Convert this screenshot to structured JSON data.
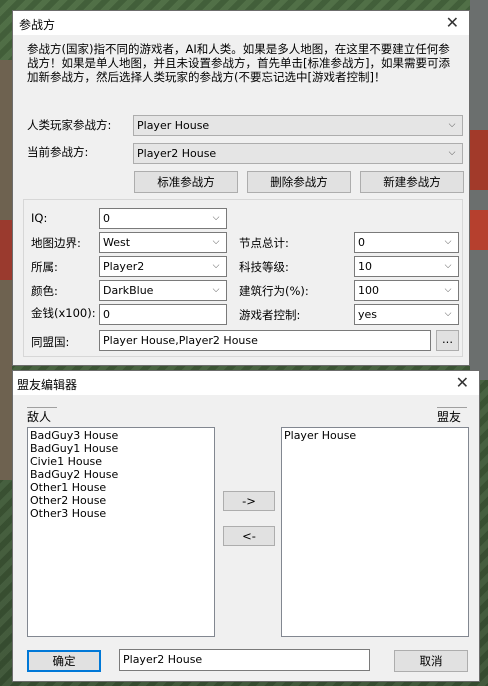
{
  "main_dialog": {
    "title": "参战方",
    "description": "参战方(国家)指不同的游戏者，AI和人类。如果是多人地图，在这里不要建立任何参战方！如果是单人地图，并且未设置参战方，首先单击[标准参战方]，如果需要可添加新参战方，然后选择人类玩家的参战方(不要忘记选中[游戏者控制]！",
    "human_player_label": "人类玩家参战方:",
    "human_player_value": "Player House",
    "current_player_label": "当前参战方:",
    "current_player_value": "Player2 House",
    "buttons": {
      "standard": "标准参战方",
      "delete": "删除参战方",
      "new": "新建参战方"
    },
    "fields": {
      "iq_label": "IQ:",
      "iq_value": "0",
      "edge_label": "地图边界:",
      "edge_value": "West",
      "owner_label": "所属:",
      "owner_value": "Player2",
      "color_label": "颜色:",
      "color_value": "DarkBlue",
      "money_label": "金钱(x100):",
      "money_value": "0",
      "nodes_label": "节点总计:",
      "nodes_value": "0",
      "tech_label": "科技等级:",
      "tech_value": "10",
      "build_label": "建筑行为(%):",
      "build_value": "100",
      "player_control_label": "游戏者控制:",
      "player_control_value": "yes",
      "allies_label": "同盟国:",
      "allies_value": "Player House,Player2 House",
      "browse_label": "..."
    }
  },
  "ally_editor": {
    "title": "盟友编辑器",
    "enemies_label": "敌人",
    "allies_label": "盟友",
    "enemies": [
      "BadGuy3 House",
      "BadGuy1 House",
      "Civie1 House",
      "BadGuy2 House",
      "Other1 House",
      "Other2 House",
      "Other3 House"
    ],
    "allies": [
      "Player House"
    ],
    "move_right_label": "->",
    "move_left_label": "<-",
    "ok_label": "确定",
    "house_value": "Player2 House",
    "cancel_label": "取消"
  }
}
